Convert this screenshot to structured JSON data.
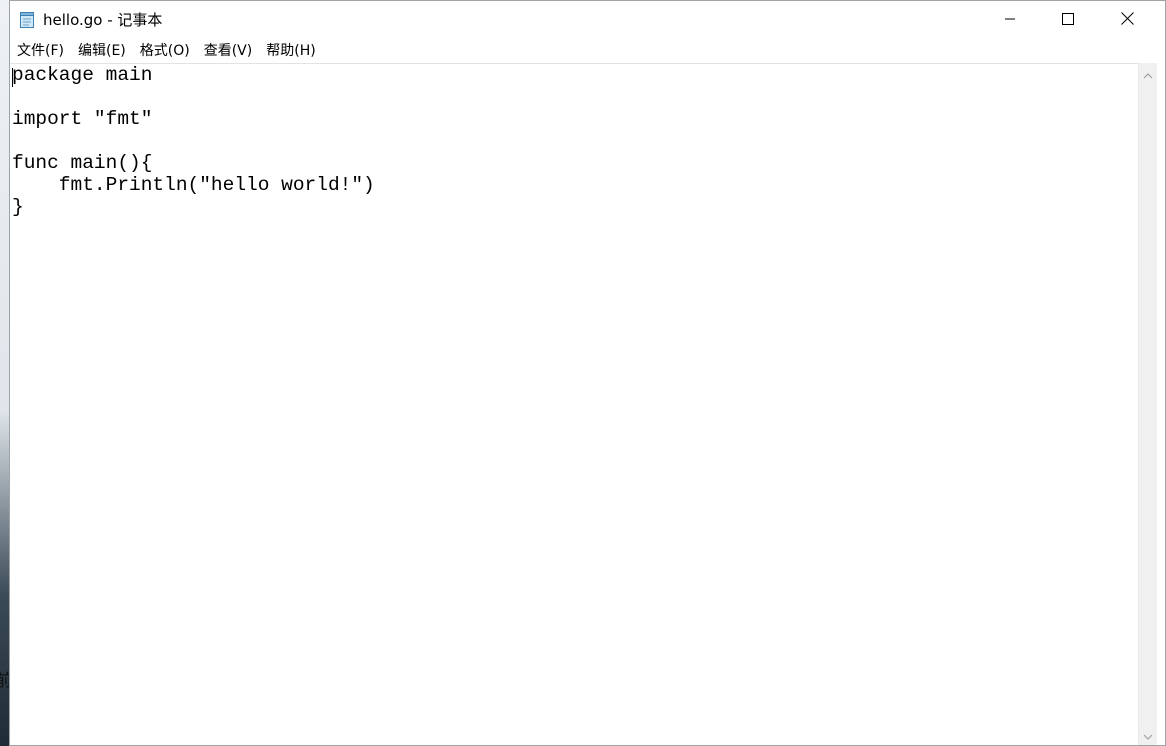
{
  "window": {
    "title": "hello.go - 记事本",
    "app_icon": "notepad-icon",
    "controls": {
      "minimize_icon": "minimize-icon",
      "maximize_icon": "maximize-icon",
      "close_icon": "close-icon"
    }
  },
  "menubar": {
    "items": [
      {
        "label": "文件(F)"
      },
      {
        "label": "编辑(E)"
      },
      {
        "label": "格式(O)"
      },
      {
        "label": "查看(V)"
      },
      {
        "label": "帮助(H)"
      }
    ]
  },
  "editor": {
    "content": "package main\n\nimport \"fmt\"\n\nfunc main(){\n    fmt.Println(\"hello world!\")\n}"
  },
  "background": {
    "partial_glyph": "前"
  },
  "scrollbar": {
    "up_icon": "chevron-up-icon",
    "down_icon": "chevron-down-icon"
  }
}
